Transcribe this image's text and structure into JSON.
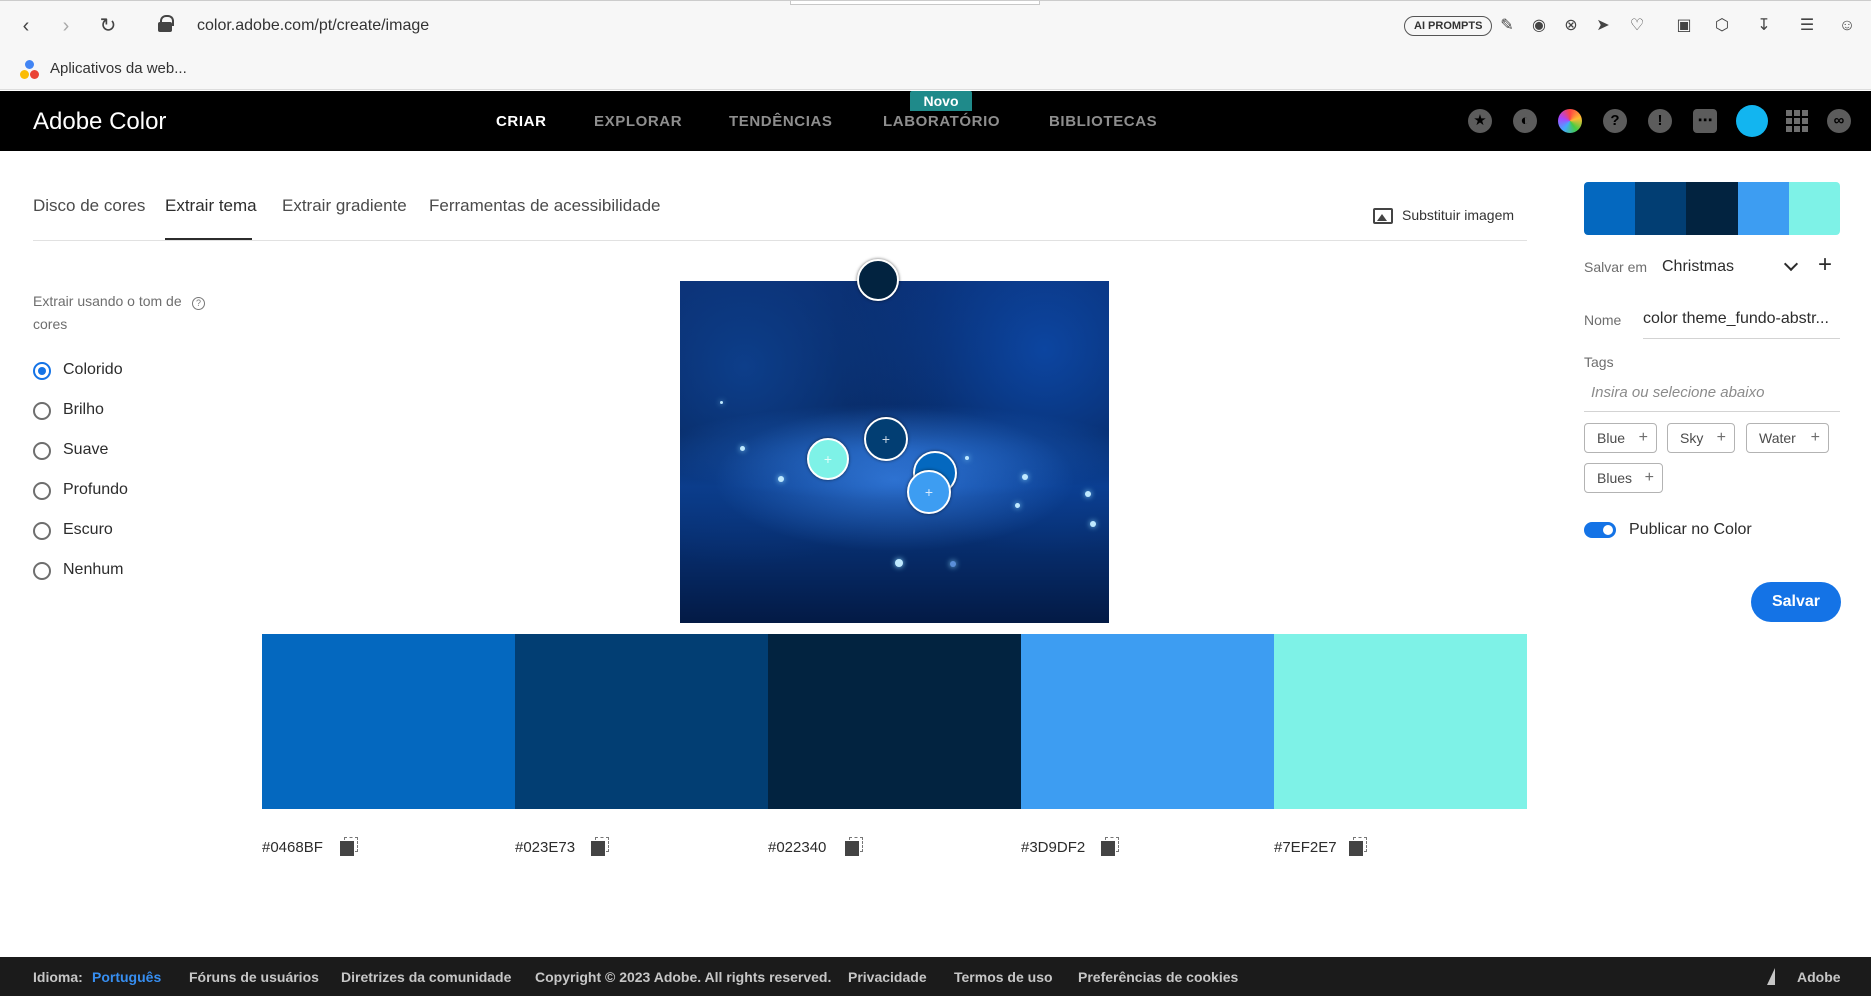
{
  "browser": {
    "url": "color.adobe.com/pt/create/image",
    "ai_button": "AI PROMPTS",
    "bookmark": "Aplicativos da web..."
  },
  "header": {
    "brand": "Adobe Color",
    "nav": [
      "CRIAR",
      "EXPLORAR",
      "TENDÊNCIAS",
      "LABORATÓRIO",
      "BIBLIOTECAS"
    ],
    "badge": "Novo"
  },
  "tabs": [
    "Disco de cores",
    "Extrair tema",
    "Extrair gradiente",
    "Ferramentas de acessibilidade"
  ],
  "replace_image": "Substituir imagem",
  "extract": {
    "title": "Extrair usando o tom de cores",
    "options": [
      "Colorido",
      "Brilho",
      "Suave",
      "Profundo",
      "Escuro",
      "Nenhum"
    ],
    "selected": "Colorido"
  },
  "theme": {
    "colors": [
      "#0468BF",
      "#023E73",
      "#022340",
      "#3D9DF2",
      "#7EF2E7"
    ],
    "hex_labels": [
      "#0468BF",
      "#023E73",
      "#022340",
      "#3D9DF2",
      "#7EF2E7"
    ]
  },
  "panel": {
    "save_in_label": "Salvar em",
    "save_in_value": "Christmas",
    "name_label": "Nome",
    "name_value": "color theme_fundo-abstr...",
    "tags_label": "Tags",
    "tags_placeholder": "Insira ou selecione abaixo",
    "tags": [
      "Blue",
      "Sky",
      "Water",
      "Blues"
    ],
    "publish_label": "Publicar no Color",
    "publish_on": true,
    "save_button": "Salvar"
  },
  "footer": {
    "language_label": "Idioma:",
    "language_value": "Português",
    "forums": "Fóruns de usuários",
    "guidelines": "Diretrizes da comunidade",
    "copyright": "Copyright © 2023 Adobe. All rights reserved.",
    "privacy": "Privacidade",
    "terms": "Termos de uso",
    "cookies": "Preferências de cookies",
    "adobe": "Adobe"
  }
}
